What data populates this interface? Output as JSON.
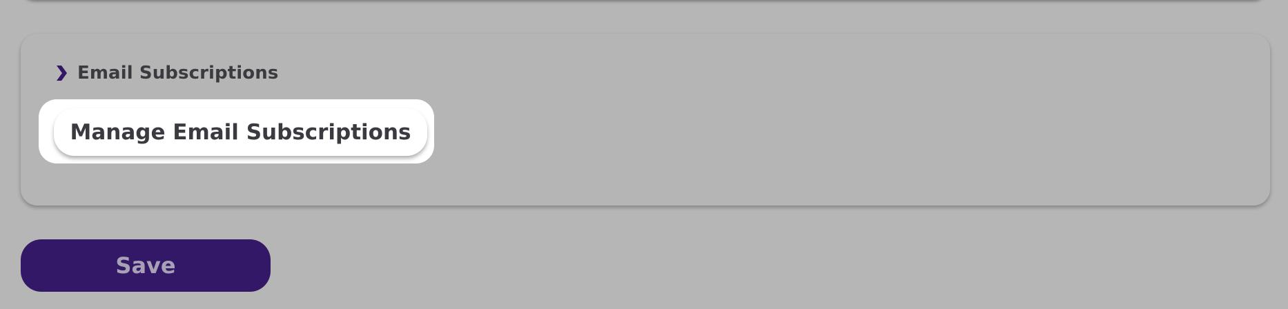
{
  "colors": {
    "background": "#b6b6b6",
    "accent": "#321866",
    "text": "#3b3a40",
    "highlight": "#ffffff",
    "save_text": "#a8a1b5"
  },
  "email_section": {
    "header_icon": "chevron-right-icon",
    "title": "Email Subscriptions",
    "manage_button_label": "Manage Email Subscriptions"
  },
  "footer": {
    "save_label": "Save"
  }
}
